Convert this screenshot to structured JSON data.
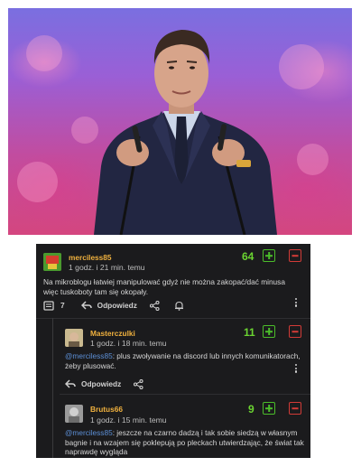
{
  "comments": [
    {
      "username": "merciless85",
      "time": "1 godz. i 21 min. temu",
      "score": "64",
      "text": "Na mikroblogu łatwiej manipulować gdyż nie można zakopać/dać minusa więc tuskoboty tam się okopały.",
      "mention": "",
      "reply_count": "7",
      "reply_label": "Odpowiedz"
    },
    {
      "username": "Masterczulki",
      "time": "1 godz. i 18 min. temu",
      "score": "11",
      "mention": "@merciless85",
      "text": ": plus zwoływanie na discord lub innych komunikatorach, żeby plusować.",
      "reply_label": "Odpowiedz"
    },
    {
      "username": "Brutus66",
      "time": "1 godz. i 15 min. temu",
      "score": "9",
      "mention": "@merciless85",
      "text": ": jeszcze na czarno dadzą i tak sobie siedzą w własnym bagnie i na wzajem się poklepują po pleckach utwierdzając, że świat tak naprawdę wygląda"
    }
  ],
  "colors": {
    "background": "#1b1b1d",
    "username": "#f0b13e",
    "score": "#6bd431",
    "upvote": "#4bbd2a",
    "downvote": "#d23b37",
    "mention": "#5c8fd6"
  },
  "icons": [
    "plus-vote-icon",
    "minus-vote-icon",
    "comments-icon",
    "reply-icon",
    "share-icon",
    "bell-icon",
    "more-options-icon"
  ]
}
